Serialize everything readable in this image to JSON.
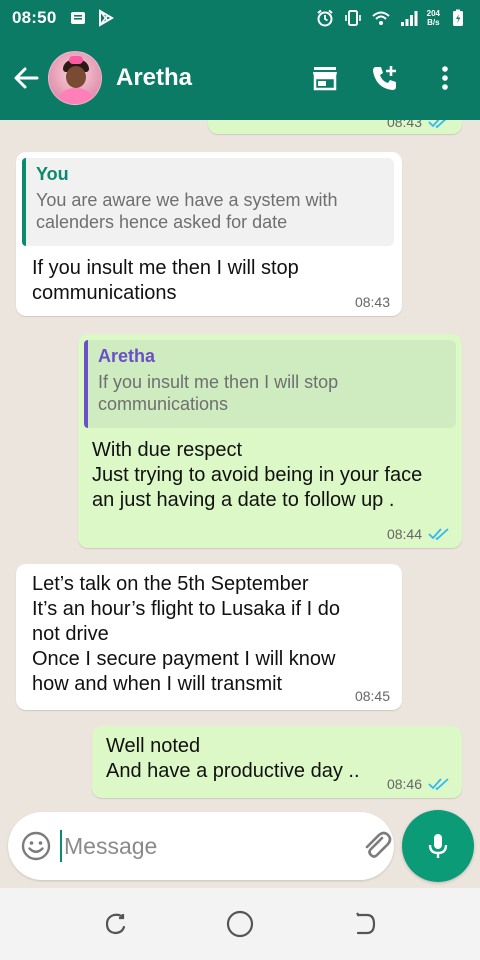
{
  "status_bar": {
    "time": "08:50",
    "net_speed_value": "204",
    "net_speed_unit": "B/s"
  },
  "header": {
    "contact_name": "Aretha"
  },
  "messages": [
    {
      "direction": "incoming",
      "quote_author": "You",
      "quote_text": "You are aware we have a system with calenders hence asked for date",
      "lines": [
        "If you insult me then I will stop",
        "communications"
      ],
      "time": "08:43"
    },
    {
      "direction": "outgoing",
      "quote_author": "Aretha",
      "quote_text": "If you insult me then I will stop communications",
      "lines": [
        "With due respect",
        "Just trying to avoid being in your face",
        "an just having a date to follow up ."
      ],
      "time": "08:44",
      "read": true
    },
    {
      "direction": "incoming",
      "lines": [
        "Let’s talk on the 5th September",
        "It’s an hour’s flight to Lusaka if I do",
        "not drive",
        "Once I secure payment I will know",
        "how and when I will transmit"
      ],
      "time": "08:45"
    },
    {
      "direction": "outgoing",
      "lines": [
        "Well noted",
        "And have a productive day .."
      ],
      "time": "08:46",
      "read": true
    }
  ],
  "previous_message": {
    "time": "08:43"
  },
  "composer": {
    "placeholder": "Message"
  },
  "colors": {
    "header": "#0b7b66",
    "outgoing_bubble": "#dcf8c6",
    "incoming_bubble": "#ffffff",
    "chat_background": "#ece5dd",
    "read_ticks": "#34b7f1",
    "mic_button": "#0b9b77"
  },
  "icons": {
    "back": "arrow-left-icon",
    "shop": "storefront-icon",
    "add_call": "add-call-icon",
    "menu": "more-vert-icon",
    "emoji": "emoji-icon",
    "attach": "paperclip-icon",
    "camera": "camera-icon",
    "mic": "microphone-icon"
  }
}
